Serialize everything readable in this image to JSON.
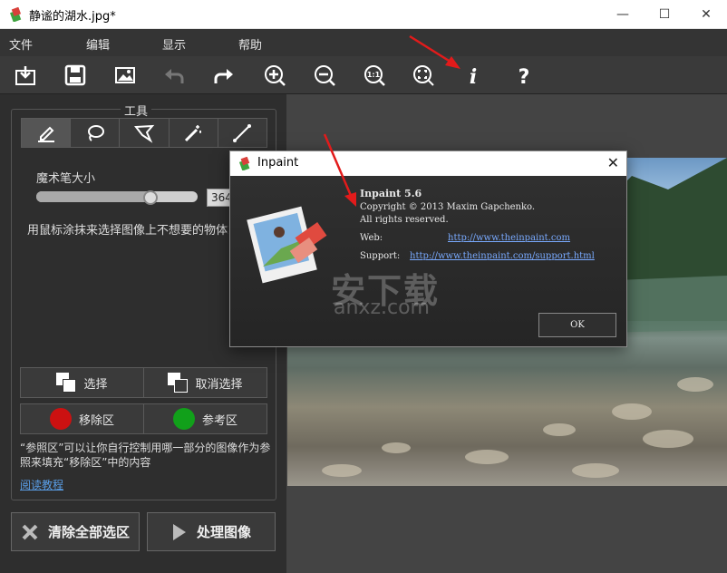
{
  "window": {
    "title": "静谧的湖水.jpg*"
  },
  "menu": [
    "文件",
    "编辑",
    "显示",
    "帮助"
  ],
  "toolbar": {
    "icons": [
      "open-icon",
      "save-icon",
      "image-icon",
      "undo-icon",
      "redo-icon",
      "zoom-in-icon",
      "zoom-out-icon",
      "zoom-1to1-icon",
      "fit-screen-icon",
      "info-icon",
      "help-icon"
    ]
  },
  "tools": {
    "title": "工具",
    "items": [
      "marker-tool",
      "lasso-tool",
      "polygon-lasso-tool",
      "magic-wand-tool",
      "line-tool"
    ],
    "active": "marker-tool"
  },
  "brush": {
    "label": "魔术笔大小",
    "value": "364",
    "level_fraction": 0.71
  },
  "hint": "用鼠标涂抹来选择图像上不想要的物体或水印",
  "selection": {
    "select_label": "选择",
    "deselect_label": "取消选择"
  },
  "regions": {
    "remove_label": "移除区",
    "reference_label": "参考区",
    "remove_color": "#cc1111",
    "reference_color": "#11a01a"
  },
  "note": "“参照区”可以让你自行控制用哪一部分的图像作为参照来填充“移除区”中的内容",
  "tutorial_link": "阅读教程",
  "actions": {
    "clear_label": "清除全部选区",
    "process_label": "处理图像"
  },
  "dialog": {
    "title": "Inpaint",
    "product": "Inpaint 5.6",
    "copyright": "Copyright © 2013 Maxim Gapchenko.",
    "rights": "All rights reserved.",
    "web_label": "Web:",
    "web_url": "http://www.theinpaint.com",
    "support_label": "Support:",
    "support_url": "http://www.theinpaint.com/support.html",
    "ok_label": "OK"
  },
  "watermark": {
    "main": "安下载",
    "sub": "anxz.com"
  }
}
